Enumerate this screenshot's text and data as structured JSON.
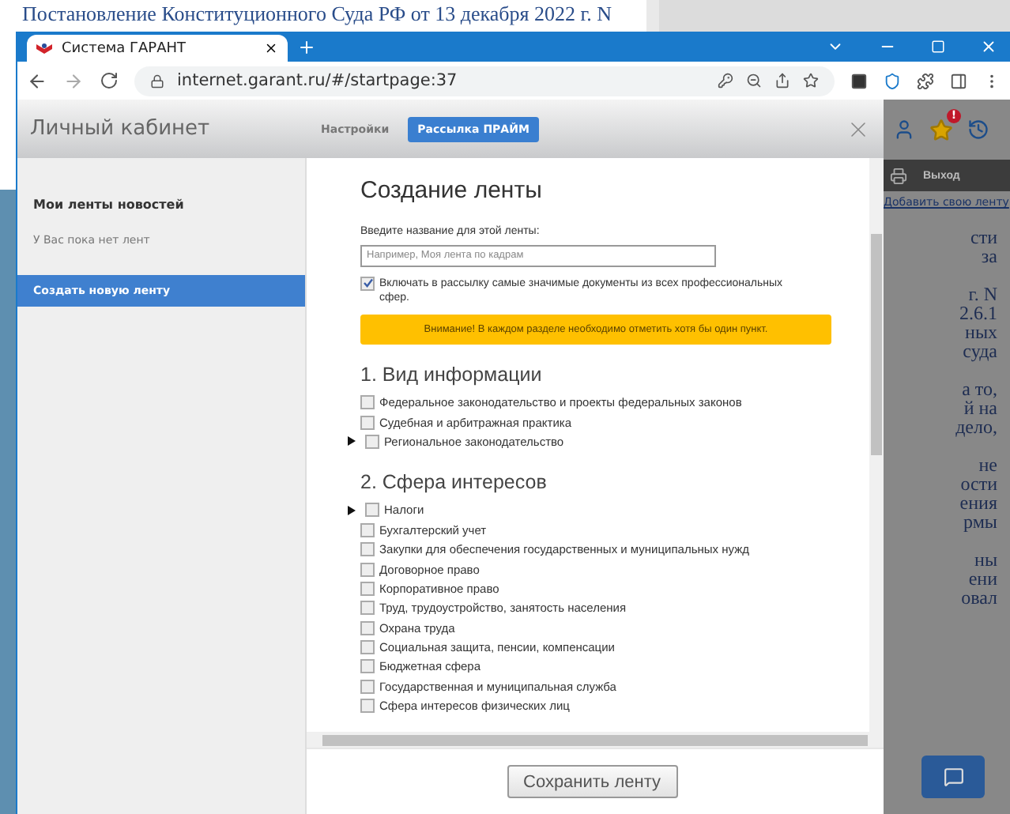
{
  "background_document": {
    "title_line": "Постановление Конституционного Суда РФ от 13 декабря 2022 г. N"
  },
  "browser": {
    "tab_title": "Система ГАРАНТ",
    "url": "internet.garant.ru/#/startpage:37"
  },
  "modal": {
    "title": "Личный кабинет",
    "tabs": [
      {
        "label": "Настройки",
        "selected": false
      },
      {
        "label": "Рассылка ПРАЙМ",
        "selected": true
      }
    ],
    "sidebar": {
      "heading": "Мои ленты новостей",
      "empty_note": "У Вас пока нет лент",
      "items": [
        {
          "label": "Создать новую ленту",
          "selected": true
        }
      ]
    },
    "form": {
      "title": "Создание ленты",
      "name_field": {
        "label": "Введите название для этой ленты:",
        "placeholder": "Например, Моя лента по кадрам"
      },
      "include_all": {
        "label": "Включать в рассылку самые значимые документы из всех профессиональных сфер.",
        "checked": true
      },
      "warning": "Внимание! В каждом разделе необходимо отметить хотя бы один пункт.",
      "sections": [
        {
          "title": "1. Вид информации",
          "items": [
            {
              "label": "Федеральное законодательство и проекты федеральных законов",
              "checked": false,
              "kind": "leaf"
            },
            {
              "label": "Судебная и арбитражная практика",
              "checked": false,
              "kind": "leaf"
            },
            {
              "label": "Региональное законодательство",
              "checked": false,
              "kind": "group"
            }
          ]
        },
        {
          "title": "2. Сфера интересов",
          "items": [
            {
              "label": "Налоги",
              "checked": false,
              "kind": "group"
            },
            {
              "label": "Бухгалтерский учет",
              "checked": false,
              "kind": "leaf"
            },
            {
              "label": "Закупки для обеспечения государственных и муниципальных нужд",
              "checked": false,
              "kind": "leaf"
            },
            {
              "label": "Договорное право",
              "checked": false,
              "kind": "leaf"
            },
            {
              "label": "Корпоративное право",
              "checked": false,
              "kind": "leaf"
            },
            {
              "label": "Труд, трудоустройство, занятость населения",
              "checked": false,
              "kind": "leaf"
            },
            {
              "label": "Охрана труда",
              "checked": false,
              "kind": "leaf"
            },
            {
              "label": "Социальная защита, пенсии, компенсации",
              "checked": false,
              "kind": "leaf"
            },
            {
              "label": "Бюджетная сфера",
              "checked": false,
              "kind": "leaf"
            },
            {
              "label": "Государственная и муниципальная служба",
              "checked": false,
              "kind": "leaf"
            },
            {
              "label": "Сфера интересов физических лиц",
              "checked": false,
              "kind": "leaf"
            }
          ]
        }
      ]
    },
    "save_button": "Сохранить ленту"
  },
  "background_page": {
    "notification_badge": "!",
    "exit_button": "Выход",
    "add_feed_link": "Добавить свою ленту",
    "paragraphs": [
      [
        "сти",
        "за"
      ],
      [
        "г. N",
        "2.6.1",
        "ных",
        "суда"
      ],
      [
        "а то,",
        "й на",
        "дело,"
      ],
      [
        "не",
        "ости",
        "ения",
        "рмы"
      ],
      [
        "ны",
        "ени",
        "овал"
      ]
    ]
  }
}
